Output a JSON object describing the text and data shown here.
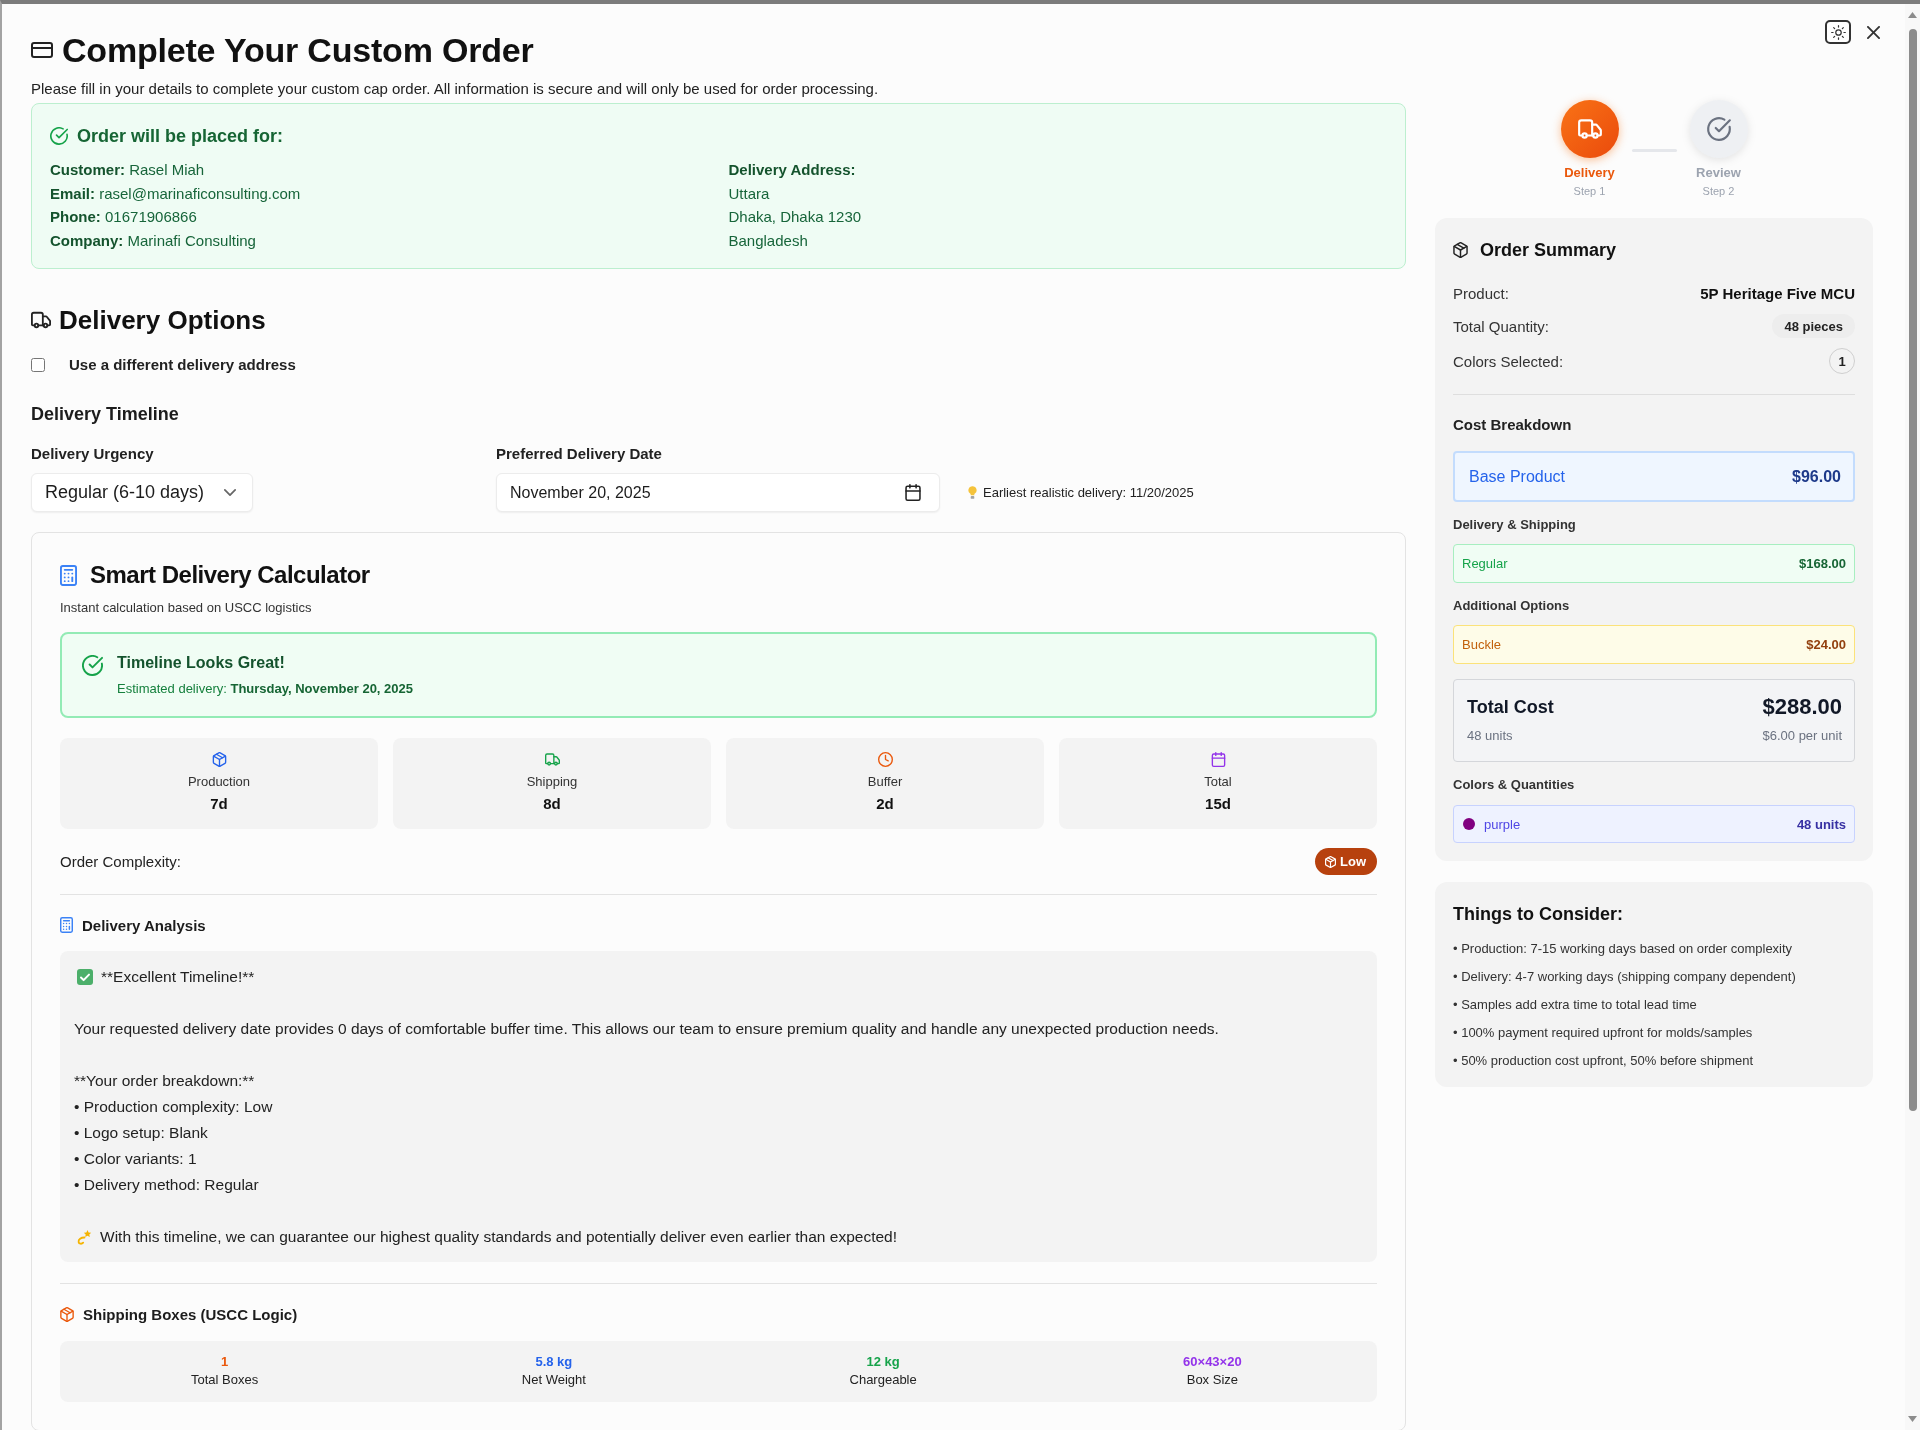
{
  "header": {
    "title": "Complete Your Custom Order",
    "subtitle": "Please fill in your details to complete your custom cap order. All information is secure and will only be used for order processing."
  },
  "order_for": {
    "title": "Order will be placed for:",
    "details": [
      "**Customer:** Rasel Miah",
      "**Email:** rasel@marinaficonsulting.com",
      "**Phone:** 01671906866",
      "**Company:** Marinafi Consulting"
    ],
    "address_label": "Delivery Address:",
    "address_lines": [
      "Uttara",
      "Dhaka, Dhaka 1230",
      "Bangladesh"
    ]
  },
  "delivery_options": {
    "title": "Delivery Options",
    "different_address": {
      "label": "Use a different delivery address",
      "checked": false
    },
    "timeline_title": "Delivery Timeline",
    "urgency": {
      "label": "Delivery Urgency",
      "value": "Regular (6-10 days)"
    },
    "date": {
      "label": "Preferred Delivery Date",
      "value": "November 20, 2025"
    },
    "hint": "Earliest realistic delivery: 11/20/2025"
  },
  "calculator": {
    "title": "Smart Delivery Calculator",
    "subtitle": "Instant calculation based on USCC logistics",
    "status": {
      "title": "Timeline Looks Great!",
      "text": "Estimated delivery: **Thursday, November 20, 2025**"
    },
    "stats": [
      {
        "kind": "production",
        "label": "Production",
        "value": "7d"
      },
      {
        "kind": "shipping",
        "label": "Shipping",
        "value": "8d"
      },
      {
        "kind": "buffer",
        "label": "Buffer",
        "value": "2d"
      },
      {
        "kind": "total",
        "label": "Total",
        "value": "15d"
      }
    ],
    "complexity": {
      "label": "Order Complexity:",
      "badge": "Low"
    },
    "analysis": {
      "title": "Delivery Analysis",
      "blocks": [
        {
          "kind": "headline",
          "text": "**Excellent Timeline!**"
        },
        {
          "kind": "paragraph",
          "text": "Your requested delivery date provides 0 days of comfortable buffer time. This allows our team to ensure premium quality and handle any unexpected production needs."
        },
        {
          "kind": "list",
          "title": "**Your order breakdown:**",
          "items": [
            "• Production complexity: Low",
            "• Logo setup: Blank",
            "• Color variants: 1",
            "• Delivery method: Regular"
          ]
        },
        {
          "kind": "closing",
          "text": "With this timeline, we can guarantee our highest quality standards and potentially deliver even earlier than expected!"
        }
      ]
    },
    "shipping": {
      "title": "Shipping Boxes (USCC Logic)",
      "stats": [
        {
          "value": "1",
          "label": "Total Boxes",
          "color": "#ea580c"
        },
        {
          "value": "5.8 kg",
          "label": "Net Weight",
          "color": "#2563eb"
        },
        {
          "value": "12 kg",
          "label": "Chargeable",
          "color": "#16a34a"
        },
        {
          "value": "60×43×20",
          "label": "Box Size",
          "color": "#9333ea"
        }
      ]
    }
  },
  "steps": [
    {
      "kind": "delivery",
      "label": "Delivery",
      "caption": "Step 1",
      "selected": true
    },
    {
      "kind": "review",
      "label": "Review",
      "caption": "Step 2",
      "selected": false
    }
  ],
  "summary": {
    "title": "Order Summary",
    "rows": [
      {
        "kind": "text",
        "label": "Product:",
        "value": "5P Heritage Five MCU"
      },
      {
        "kind": "pill",
        "label": "Total Quantity:",
        "value": "48 pieces"
      },
      {
        "kind": "count",
        "label": "Colors Selected:",
        "value": "1"
      }
    ],
    "cost_title": "Cost Breakdown",
    "cost_groups": [
      {
        "kind": "base",
        "label": "Base Product",
        "price": "$96.00"
      },
      {
        "kind": "shipping",
        "title": "Delivery & Shipping",
        "label": "Regular",
        "price": "$168.00"
      },
      {
        "kind": "option",
        "title": "Additional Options",
        "label": "Buckle",
        "price": "$24.00"
      }
    ],
    "total": {
      "label": "Total Cost",
      "price": "$288.00",
      "units": "48 units",
      "per_unit": "$6.00 per unit"
    },
    "colors_title": "Colors & Quantities",
    "colors": [
      {
        "name": "purple",
        "quantity": "48 units",
        "color": "#800080"
      }
    ]
  },
  "considerations": {
    "title": "Things to Consider:",
    "items": [
      "• Production: 7-15 working days based on order complexity",
      "• Delivery: 4-7 working days (shipping company dependent)",
      "• Samples add extra time to total lead time",
      "• 100% payment required upfront for molds/samples",
      "• 50% production cost upfront, 50% before shipment"
    ]
  }
}
